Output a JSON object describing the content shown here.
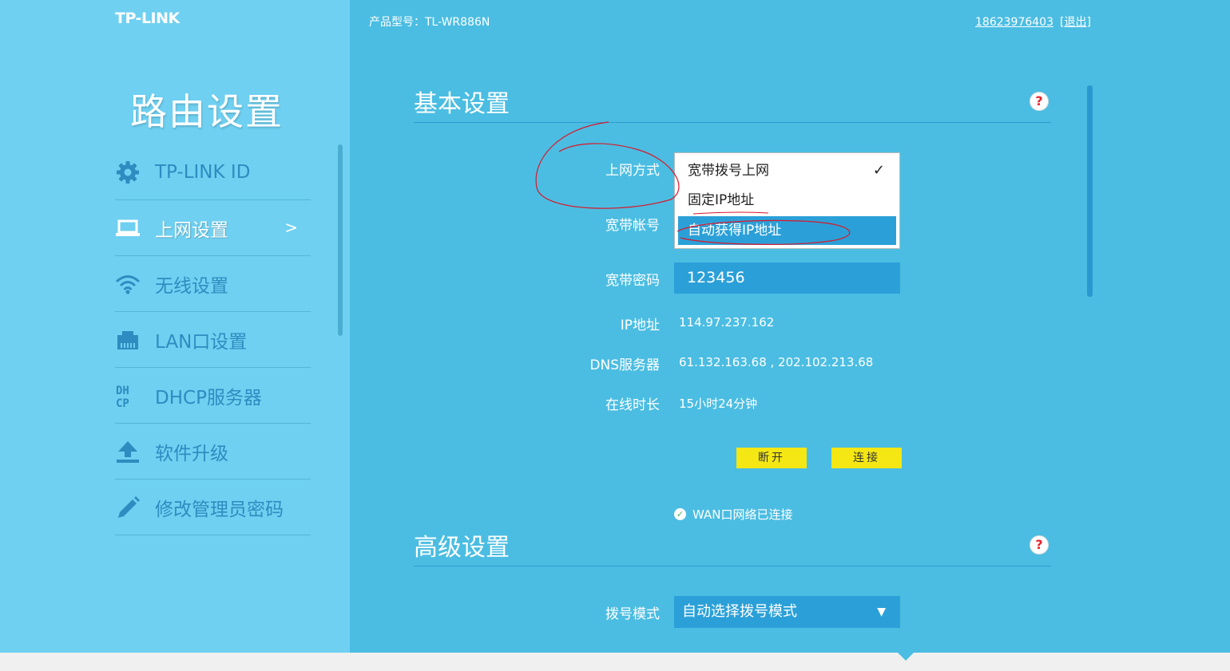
{
  "brand": {
    "logo": "TP-LINK"
  },
  "sidebar": {
    "title": "路由设置",
    "items": [
      {
        "label": "TP-LINK ID",
        "icon": "gear-icon"
      },
      {
        "label": "上网设置",
        "icon": "laptop-icon",
        "active": true,
        "arrow": ">"
      },
      {
        "label": "无线设置",
        "icon": "wifi-icon"
      },
      {
        "label": "LAN口设置",
        "icon": "lan-port-icon"
      },
      {
        "label": "DHCP服务器",
        "icon": "dhcp-icon"
      },
      {
        "label": "软件升级",
        "icon": "upload-icon"
      },
      {
        "label": "修改管理员密码",
        "icon": "pencil-icon"
      }
    ]
  },
  "header": {
    "model": "产品型号：TL-WR886N",
    "user_phone": "18623976403",
    "logout": "[退出]"
  },
  "basic": {
    "title": "基本设置",
    "help": "?",
    "conn_type_label": "上网方式",
    "conn_type_options": [
      "宽带拨号上网",
      "固定IP地址",
      "自动获得IP地址"
    ],
    "conn_type_checked": "✓",
    "account_label": "宽带帐号",
    "password_label": "宽带密码",
    "password_value": "123456",
    "ip_label": "IP地址",
    "ip_value": "114.97.237.162",
    "dns_label": "DNS服务器",
    "dns_value": "61.132.163.68 , 202.102.213.68",
    "uptime_label": "在线时长",
    "uptime_value": "15小时24分钟",
    "disconnect_btn": "断开",
    "connect_btn": "连接",
    "status_text": "WAN口网络已连接"
  },
  "advanced": {
    "title": "高级设置",
    "help": "?",
    "dial_mode_label": "拨号模式",
    "dial_mode_value": "自动选择拨号模式"
  },
  "colors": {
    "background": "#4bbde2",
    "sidebar": "#6fd0f1",
    "field": "#2ba0d8",
    "button": "#f4e713",
    "annotation": "#d9182a"
  }
}
